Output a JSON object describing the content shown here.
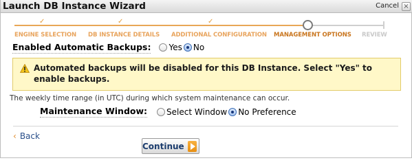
{
  "window": {
    "title": "Launch DB Instance Wizard",
    "cancel_label": "Cancel",
    "close_glyph": "×"
  },
  "steps": [
    {
      "label": "ENGINE SELECTION",
      "state": "done"
    },
    {
      "label": "DB INSTANCE DETAILS",
      "state": "done"
    },
    {
      "label": "ADDITIONAL CONFIGURATION",
      "state": "done"
    },
    {
      "label": "MANAGEMENT OPTIONS",
      "state": "current"
    },
    {
      "label": "REVIEW",
      "state": "future"
    }
  ],
  "backups": {
    "label": "Enabled Automatic Backups:",
    "options": [
      {
        "label": "Yes",
        "checked": false
      },
      {
        "label": "No",
        "checked": true
      }
    ]
  },
  "warning": {
    "text": "Automated backups will be disabled for this DB Instance. Select \"Yes\" to enable backups.",
    "icon": "warning-icon"
  },
  "maintenance": {
    "info": "The weekly time range (in UTC) during which system maintenance can occur.",
    "label": "Maintenance Window:",
    "options": [
      {
        "label": "Select Window",
        "checked": false
      },
      {
        "label": "No Preference",
        "checked": true
      }
    ]
  },
  "nav": {
    "back_glyph": "‹",
    "back_label": "Back",
    "continue_label": "Continue"
  },
  "colors": {
    "accent": "#e8a45d",
    "link": "#2a4f8a",
    "warning_bg": "#fff8c8"
  }
}
